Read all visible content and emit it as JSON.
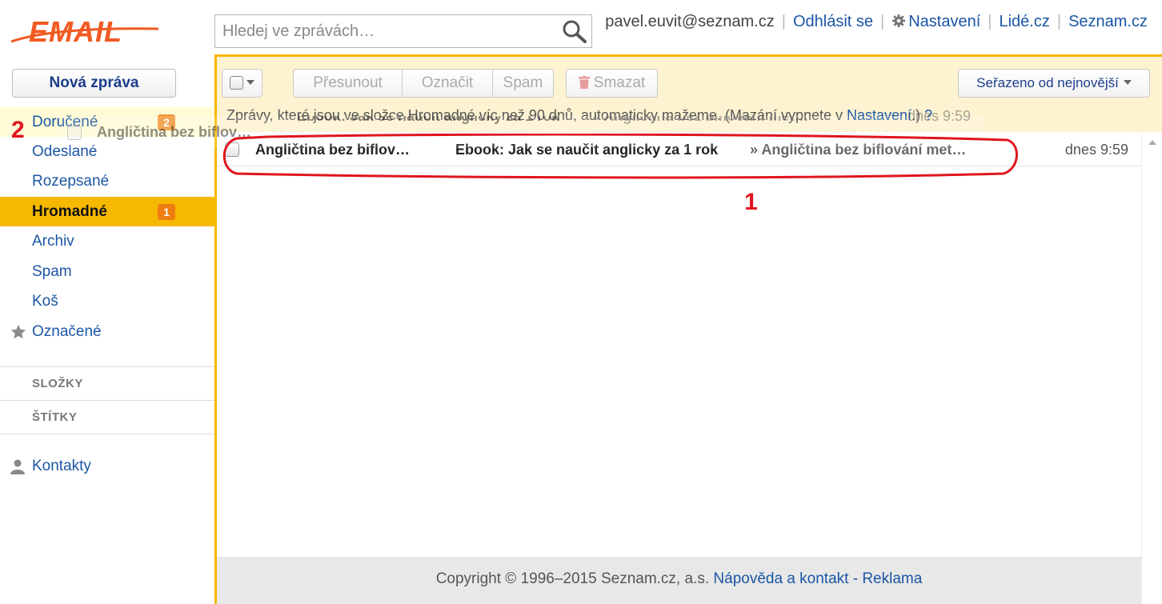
{
  "logo": {
    "text": "EMAIL",
    "color": "#f15a22"
  },
  "search": {
    "placeholder": "Hledej ve zprávách…",
    "icon": "magnifier-icon"
  },
  "top": {
    "user": "pavel.euvit@seznam.cz",
    "logout": "Odhlásit se",
    "settings": "Nastavení",
    "lide": "Lidé.cz",
    "seznam": "Seznam.cz"
  },
  "sidebar": {
    "new_message": "Nová zpráva",
    "folders": [
      {
        "label": "Doručené",
        "badge": "2"
      },
      {
        "label": "Odeslané"
      },
      {
        "label": "Rozepsané"
      },
      {
        "label": "Hromadné",
        "badge": "1",
        "active": true
      },
      {
        "label": "Archiv"
      },
      {
        "label": "Spam"
      },
      {
        "label": "Koš"
      },
      {
        "label": "Označené",
        "icon": "star-icon"
      }
    ],
    "sections": [
      "SLOŽKY",
      "ŠTÍTKY"
    ],
    "contacts": "Kontakty"
  },
  "toolbar": {
    "move": "Přesunout",
    "mark": "Označit",
    "spam": "Spam",
    "delete": "Smazat",
    "sort": "Seřazeno od nejnovější",
    "notice_text": "Zprávy, které jsou ve složce Hromadné víc než 90 dnů, automaticky mažeme. (Mazání vypnete v ",
    "notice_link": "Nastavení",
    "notice_end": ".)",
    "notice_help": "?"
  },
  "messages": [
    {
      "from": "Angličtina bez biflov…",
      "subject": "Ebook: Jak se naučit anglicky za 1 rok",
      "snippet": "» Angličtina bez biflování met…",
      "time": "dnes 9:59"
    }
  ],
  "drag_ghost": {
    "from": "Angličtina bez biflov…",
    "subject": "Ebook: Jak se naučit anglicky za 1 rok",
    "snippet": "» Angličtina bez biflování met…",
    "time": "dnes 9:59"
  },
  "annotations": {
    "one": "1",
    "two": "2",
    "color": "#e0151f"
  },
  "footer": {
    "copyright": "Copyright © 1996–2015 Seznam.cz, a.s.",
    "help": "Nápověda a kontakt",
    "dash": "-",
    "ads": "Reklama"
  },
  "colors": {
    "accent": "#f6b800",
    "link": "#1b56a6",
    "badge": "#f07d12",
    "toolbar_bg": "#fdf3d1"
  }
}
